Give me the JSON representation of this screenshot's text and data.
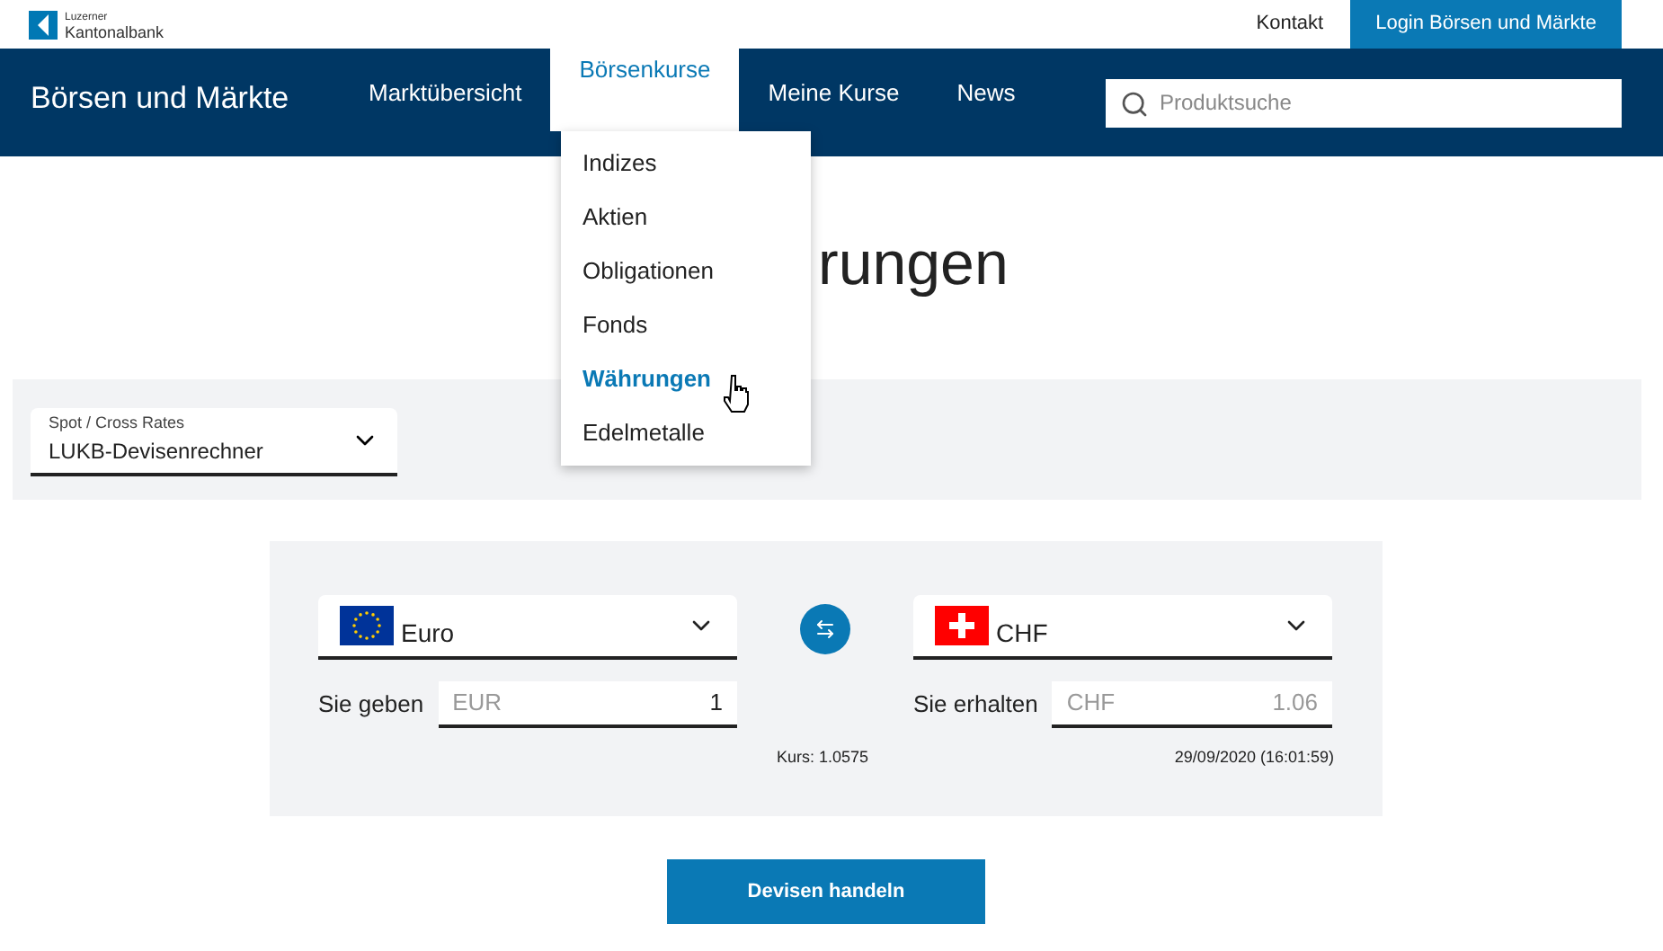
{
  "logo": {
    "line1": "Luzerner",
    "line2": "Kantonalbank"
  },
  "top_links": [
    {
      "label": "Kontakt",
      "kind": "link"
    },
    {
      "label": "Login Börsen und Märkte",
      "kind": "button"
    }
  ],
  "nav": {
    "title": "Börsen und Märkte",
    "items": [
      {
        "label": "Marktübersicht",
        "selected": false
      },
      {
        "label": "Börsenkurse",
        "selected": true
      },
      {
        "label": "Meine Kurse",
        "selected": false
      },
      {
        "label": "News",
        "selected": false
      }
    ],
    "search": {
      "placeholder": "Produktsuche"
    }
  },
  "dropdown_menu": [
    {
      "label": "Indizes",
      "selected": false
    },
    {
      "label": "Aktien",
      "selected": false
    },
    {
      "label": "Obligationen",
      "selected": false
    },
    {
      "label": "Fonds",
      "selected": false
    },
    {
      "label": "Währungen",
      "selected": true
    },
    {
      "label": "Edelmetalle",
      "selected": false
    }
  ],
  "page_title": "rungen",
  "rate_select": {
    "label": "Spot / Cross Rates",
    "value": "LUKB-Devisenrechner"
  },
  "converter": {
    "from": {
      "currency": "Euro",
      "kind": "eu",
      "label": "Sie geben",
      "code": "EUR",
      "amount": "1"
    },
    "to": {
      "currency": "CHF",
      "kind": "ch",
      "label": "Sie erhalten",
      "code": "CHF",
      "amount": "1.06"
    },
    "rate": "Kurs: 1.0575",
    "timestamp": "29/09/2020 (16:01:59)"
  },
  "action_button": "Devisen handeln"
}
